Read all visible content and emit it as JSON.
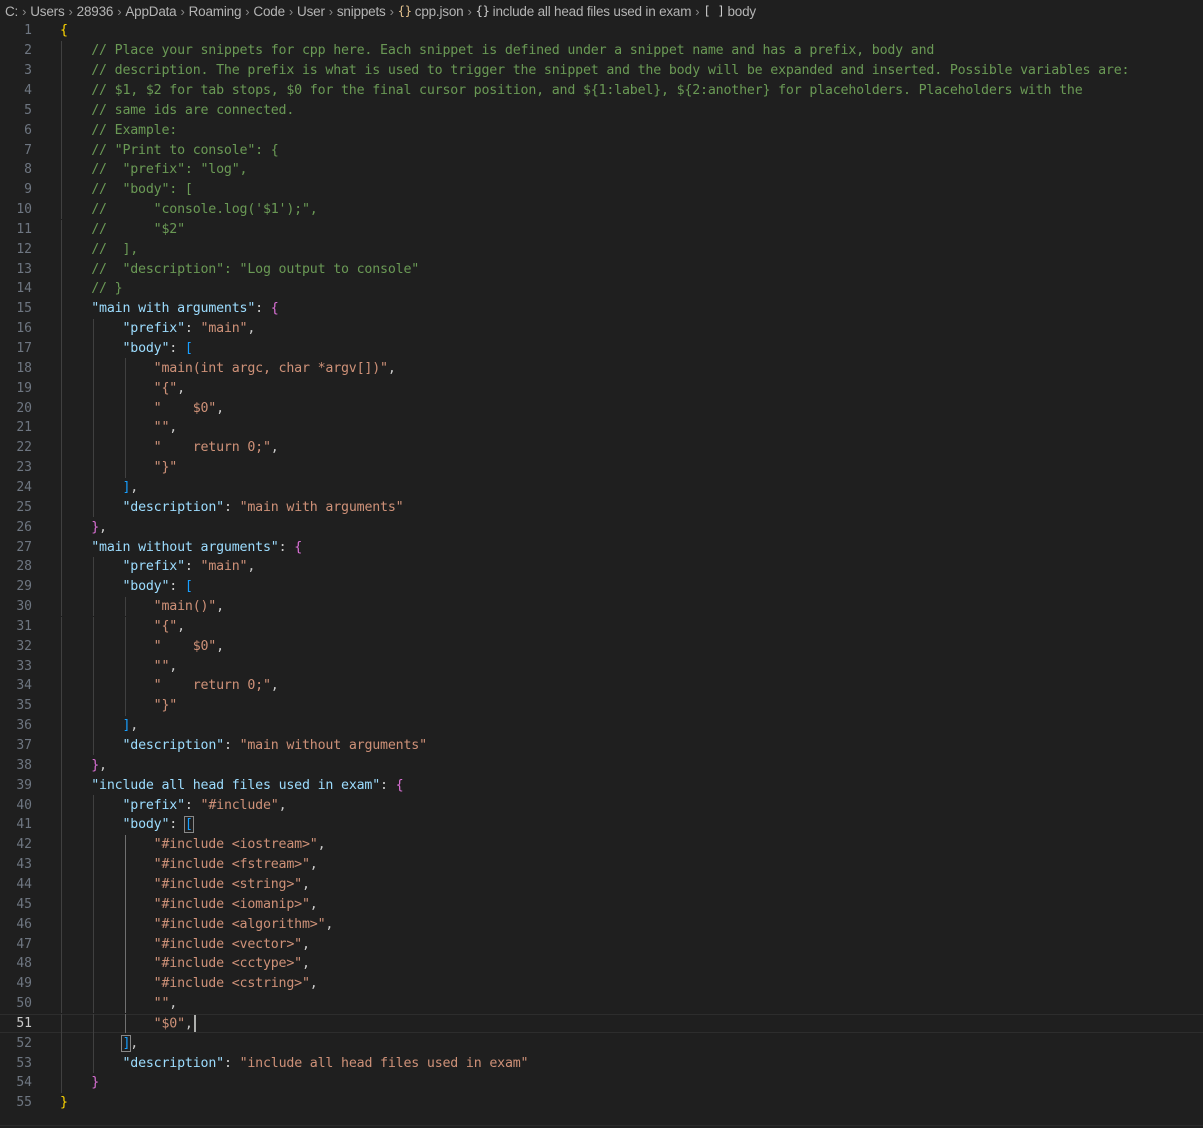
{
  "breadcrumb": {
    "items": [
      "C:",
      "Users",
      "28936",
      "AppData",
      "Roaming",
      "Code",
      "User",
      "snippets",
      "cpp.json",
      "include all head files used in exam",
      "body"
    ],
    "icons": {
      "file": "json-braces-icon",
      "object": "object-braces-icon",
      "array": "array-brackets-icon"
    },
    "glyphs": {
      "file": "{}",
      "object": "{}",
      "array": "[ ]"
    }
  },
  "editor": {
    "active_line": 51,
    "lines": [
      [
        {
          "t": "{",
          "c": "b1"
        }
      ],
      [
        {
          "t": "    // Place your snippets for cpp here. Each snippet is defined under a snippet name and has a prefix, body and",
          "c": "c-comment"
        }
      ],
      [
        {
          "t": "    // description. The prefix is what is used to trigger the snippet and the body will be expanded and inserted. Possible variables are:",
          "c": "c-comment"
        }
      ],
      [
        {
          "t": "    // $1, $2 for tab stops, $0 for the final cursor position, and ${1:label}, ${2:another} for placeholders. Placeholders with the",
          "c": "c-comment"
        }
      ],
      [
        {
          "t": "    // same ids are connected.",
          "c": "c-comment"
        }
      ],
      [
        {
          "t": "    // Example:",
          "c": "c-comment"
        }
      ],
      [
        {
          "t": "    // \"Print to console\": {",
          "c": "c-comment"
        }
      ],
      [
        {
          "t": "    //  \"prefix\": \"log\",",
          "c": "c-comment"
        }
      ],
      [
        {
          "t": "    //  \"body\": [",
          "c": "c-comment"
        }
      ],
      [
        {
          "t": "    //      \"console.log('$1');\",",
          "c": "c-comment"
        }
      ],
      [
        {
          "t": "    //      \"$2\"",
          "c": "c-comment"
        }
      ],
      [
        {
          "t": "    //  ],",
          "c": "c-comment"
        }
      ],
      [
        {
          "t": "    //  \"description\": \"Log output to console\"",
          "c": "c-comment"
        }
      ],
      [
        {
          "t": "    // }",
          "c": "c-comment"
        }
      ],
      [
        {
          "t": "    ",
          "c": ""
        },
        {
          "t": "\"main with arguments\"",
          "c": "c-key"
        },
        {
          "t": ": ",
          "c": "c-punct"
        },
        {
          "t": "{",
          "c": "b2"
        }
      ],
      [
        {
          "t": "        ",
          "c": ""
        },
        {
          "t": "\"prefix\"",
          "c": "c-key"
        },
        {
          "t": ": ",
          "c": "c-punct"
        },
        {
          "t": "\"main\"",
          "c": "c-str"
        },
        {
          "t": ",",
          "c": "c-punct"
        }
      ],
      [
        {
          "t": "        ",
          "c": ""
        },
        {
          "t": "\"body\"",
          "c": "c-key"
        },
        {
          "t": ": ",
          "c": "c-punct"
        },
        {
          "t": "[",
          "c": "b3"
        }
      ],
      [
        {
          "t": "            ",
          "c": ""
        },
        {
          "t": "\"main(int argc, char *argv[])\"",
          "c": "c-str"
        },
        {
          "t": ",",
          "c": "c-punct"
        }
      ],
      [
        {
          "t": "            ",
          "c": ""
        },
        {
          "t": "\"{\"",
          "c": "c-str"
        },
        {
          "t": ",",
          "c": "c-punct"
        }
      ],
      [
        {
          "t": "            ",
          "c": ""
        },
        {
          "t": "\"    $0\"",
          "c": "c-str"
        },
        {
          "t": ",",
          "c": "c-punct"
        }
      ],
      [
        {
          "t": "            ",
          "c": ""
        },
        {
          "t": "\"\"",
          "c": "c-str"
        },
        {
          "t": ",",
          "c": "c-punct"
        }
      ],
      [
        {
          "t": "            ",
          "c": ""
        },
        {
          "t": "\"    return 0;\"",
          "c": "c-str"
        },
        {
          "t": ",",
          "c": "c-punct"
        }
      ],
      [
        {
          "t": "            ",
          "c": ""
        },
        {
          "t": "\"}\"",
          "c": "c-str"
        }
      ],
      [
        {
          "t": "        ",
          "c": ""
        },
        {
          "t": "]",
          "c": "b3"
        },
        {
          "t": ",",
          "c": "c-punct"
        }
      ],
      [
        {
          "t": "        ",
          "c": ""
        },
        {
          "t": "\"description\"",
          "c": "c-key"
        },
        {
          "t": ": ",
          "c": "c-punct"
        },
        {
          "t": "\"main with arguments\"",
          "c": "c-str"
        }
      ],
      [
        {
          "t": "    ",
          "c": ""
        },
        {
          "t": "}",
          "c": "b2"
        },
        {
          "t": ",",
          "c": "c-punct"
        }
      ],
      [
        {
          "t": "    ",
          "c": ""
        },
        {
          "t": "\"main without arguments\"",
          "c": "c-key"
        },
        {
          "t": ": ",
          "c": "c-punct"
        },
        {
          "t": "{",
          "c": "b2"
        }
      ],
      [
        {
          "t": "        ",
          "c": ""
        },
        {
          "t": "\"prefix\"",
          "c": "c-key"
        },
        {
          "t": ": ",
          "c": "c-punct"
        },
        {
          "t": "\"main\"",
          "c": "c-str"
        },
        {
          "t": ",",
          "c": "c-punct"
        }
      ],
      [
        {
          "t": "        ",
          "c": ""
        },
        {
          "t": "\"body\"",
          "c": "c-key"
        },
        {
          "t": ": ",
          "c": "c-punct"
        },
        {
          "t": "[",
          "c": "b3"
        }
      ],
      [
        {
          "t": "            ",
          "c": ""
        },
        {
          "t": "\"main()\"",
          "c": "c-str"
        },
        {
          "t": ",",
          "c": "c-punct"
        }
      ],
      [
        {
          "t": "            ",
          "c": ""
        },
        {
          "t": "\"{\"",
          "c": "c-str"
        },
        {
          "t": ",",
          "c": "c-punct"
        }
      ],
      [
        {
          "t": "            ",
          "c": ""
        },
        {
          "t": "\"    $0\"",
          "c": "c-str"
        },
        {
          "t": ",",
          "c": "c-punct"
        }
      ],
      [
        {
          "t": "            ",
          "c": ""
        },
        {
          "t": "\"\"",
          "c": "c-str"
        },
        {
          "t": ",",
          "c": "c-punct"
        }
      ],
      [
        {
          "t": "            ",
          "c": ""
        },
        {
          "t": "\"    return 0;\"",
          "c": "c-str"
        },
        {
          "t": ",",
          "c": "c-punct"
        }
      ],
      [
        {
          "t": "            ",
          "c": ""
        },
        {
          "t": "\"}\"",
          "c": "c-str"
        }
      ],
      [
        {
          "t": "        ",
          "c": ""
        },
        {
          "t": "]",
          "c": "b3"
        },
        {
          "t": ",",
          "c": "c-punct"
        }
      ],
      [
        {
          "t": "        ",
          "c": ""
        },
        {
          "t": "\"description\"",
          "c": "c-key"
        },
        {
          "t": ": ",
          "c": "c-punct"
        },
        {
          "t": "\"main without arguments\"",
          "c": "c-str"
        }
      ],
      [
        {
          "t": "    ",
          "c": ""
        },
        {
          "t": "}",
          "c": "b2"
        },
        {
          "t": ",",
          "c": "c-punct"
        }
      ],
      [
        {
          "t": "    ",
          "c": ""
        },
        {
          "t": "\"include all head files used in exam\"",
          "c": "c-key"
        },
        {
          "t": ": ",
          "c": "c-punct"
        },
        {
          "t": "{",
          "c": "b2"
        }
      ],
      [
        {
          "t": "        ",
          "c": ""
        },
        {
          "t": "\"prefix\"",
          "c": "c-key"
        },
        {
          "t": ": ",
          "c": "c-punct"
        },
        {
          "t": "\"#include\"",
          "c": "c-str"
        },
        {
          "t": ",",
          "c": "c-punct"
        }
      ],
      [
        {
          "t": "        ",
          "c": ""
        },
        {
          "t": "\"body\"",
          "c": "c-key"
        },
        {
          "t": ": ",
          "c": "c-punct"
        },
        {
          "t": "[",
          "c": "b3 bm"
        }
      ],
      [
        {
          "t": "            ",
          "c": ""
        },
        {
          "t": "\"#include <iostream>\"",
          "c": "c-str"
        },
        {
          "t": ",",
          "c": "c-punct"
        }
      ],
      [
        {
          "t": "            ",
          "c": ""
        },
        {
          "t": "\"#include <fstream>\"",
          "c": "c-str"
        },
        {
          "t": ",",
          "c": "c-punct"
        }
      ],
      [
        {
          "t": "            ",
          "c": ""
        },
        {
          "t": "\"#include <string>\"",
          "c": "c-str"
        },
        {
          "t": ",",
          "c": "c-punct"
        }
      ],
      [
        {
          "t": "            ",
          "c": ""
        },
        {
          "t": "\"#include <iomanip>\"",
          "c": "c-str"
        },
        {
          "t": ",",
          "c": "c-punct"
        }
      ],
      [
        {
          "t": "            ",
          "c": ""
        },
        {
          "t": "\"#include <algorithm>\"",
          "c": "c-str"
        },
        {
          "t": ",",
          "c": "c-punct"
        }
      ],
      [
        {
          "t": "            ",
          "c": ""
        },
        {
          "t": "\"#include <vector>\"",
          "c": "c-str"
        },
        {
          "t": ",",
          "c": "c-punct"
        }
      ],
      [
        {
          "t": "            ",
          "c": ""
        },
        {
          "t": "\"#include <cctype>\"",
          "c": "c-str"
        },
        {
          "t": ",",
          "c": "c-punct"
        }
      ],
      [
        {
          "t": "            ",
          "c": ""
        },
        {
          "t": "\"#include <cstring>\"",
          "c": "c-str"
        },
        {
          "t": ",",
          "c": "c-punct"
        }
      ],
      [
        {
          "t": "            ",
          "c": ""
        },
        {
          "t": "\"\"",
          "c": "c-str"
        },
        {
          "t": ",",
          "c": "c-punct"
        }
      ],
      [
        {
          "t": "            ",
          "c": ""
        },
        {
          "t": "\"$0\"",
          "c": "c-str"
        },
        {
          "t": ",",
          "c": "c-punct"
        }
      ],
      [
        {
          "t": "        ",
          "c": ""
        },
        {
          "t": "]",
          "c": "b3 bm"
        },
        {
          "t": ",",
          "c": "c-punct"
        }
      ],
      [
        {
          "t": "        ",
          "c": ""
        },
        {
          "t": "\"description\"",
          "c": "c-key"
        },
        {
          "t": ": ",
          "c": "c-punct"
        },
        {
          "t": "\"include all head files used in exam\"",
          "c": "c-str"
        }
      ],
      [
        {
          "t": "    ",
          "c": ""
        },
        {
          "t": "}",
          "c": "b2"
        }
      ],
      [
        {
          "t": "}",
          "c": "b1"
        }
      ]
    ]
  }
}
